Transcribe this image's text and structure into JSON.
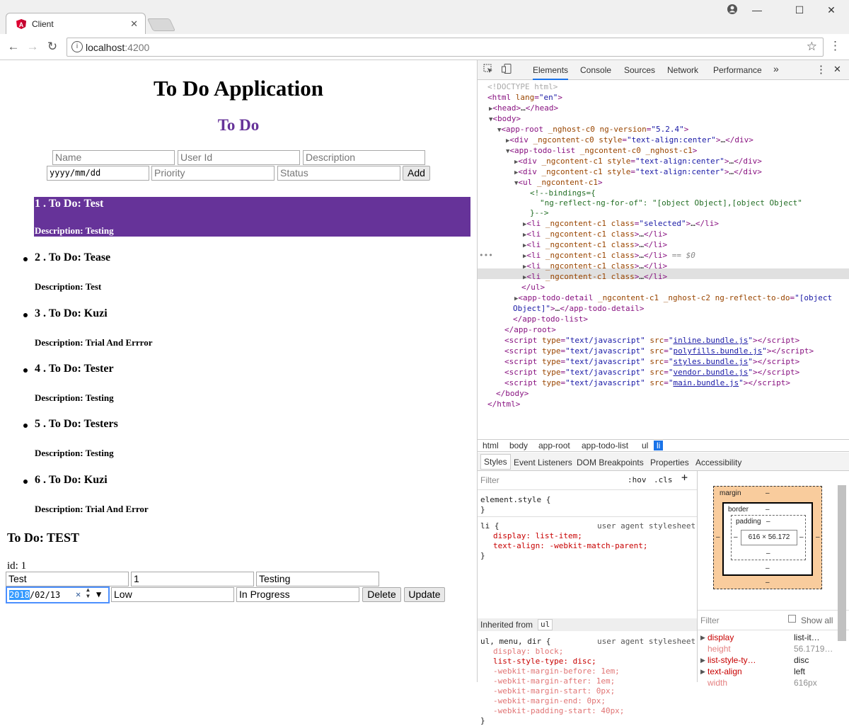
{
  "browser": {
    "tab_title": "Client",
    "url_host": "localhost",
    "url_port": ":4200"
  },
  "page": {
    "title": "To Do Application",
    "subtitle": "To Do",
    "form": {
      "name_placeholder": "Name",
      "userid_placeholder": "User Id",
      "description_placeholder": "Description",
      "date_placeholder": "yyyy/mm/dd",
      "priority_placeholder": "Priority",
      "status_placeholder": "Status",
      "add_label": "Add"
    },
    "items": [
      {
        "title": "1 . To Do: Test",
        "desc": "Description: Testing"
      },
      {
        "title": "2 . To Do: Tease",
        "desc": "Description: Test"
      },
      {
        "title": "3 . To Do: Kuzi",
        "desc": "Description: Trial And Errror"
      },
      {
        "title": "4 . To Do: Tester",
        "desc": "Description: Testing"
      },
      {
        "title": "5 . To Do: Testers",
        "desc": "Description: Testing"
      },
      {
        "title": "6 . To Do: Kuzi",
        "desc": "Description: Trial And Error"
      }
    ],
    "detail": {
      "title": "To Do: TEST",
      "id_label": "id: 1",
      "name_value": "Test",
      "userid_value": "1",
      "description_value": "Testing",
      "date_year": "2018",
      "date_rest": "/02/13",
      "priority_value": "Low",
      "status_value": "In Progress",
      "delete_label": "Delete",
      "update_label": "Update"
    }
  },
  "devtools": {
    "tabs": [
      "Elements",
      "Console",
      "Sources",
      "Network",
      "Performance"
    ],
    "breadcrumbs": [
      "html",
      "body",
      "app-root",
      "app-todo-list",
      "ul",
      "li"
    ],
    "style_tabs": [
      "Styles",
      "Event Listeners",
      "DOM Breakpoints",
      "Properties",
      "Accessibility"
    ],
    "filter_label": "Filter",
    "hov_label": ":hov",
    "cls_label": ".cls",
    "element_style": "element.style {",
    "li_selector": "li {",
    "user_agent": "user agent stylesheet",
    "li_display": "display: list-item;",
    "li_text_align": "text-align: -webkit-match-parent;",
    "inherited_from": "Inherited from",
    "inherited_tag": "ul",
    "ul_selector": "ul, menu, dir {",
    "ul_rules": [
      "display: block;",
      "list-style-type: disc;",
      "-webkit-margin-before: 1em;",
      "-webkit-margin-after: 1em;",
      "-webkit-margin-start: 0px;",
      "-webkit-margin-end: 0px;",
      "-webkit-padding-start: 40px;"
    ],
    "box_model": {
      "margin_label": "margin",
      "border_label": "border",
      "padding_label": "padding",
      "dash": "–",
      "content_size": "616 × 56.172"
    },
    "computed_filter": "Filter",
    "show_all": "Show all",
    "computed": [
      {
        "prop": "display",
        "value": "list-it…"
      },
      {
        "prop": "height",
        "value": "56.1719…"
      },
      {
        "prop": "list-style-ty…",
        "value": "disc"
      },
      {
        "prop": "text-align",
        "value": "left"
      },
      {
        "prop": "width",
        "value": "616px"
      }
    ]
  },
  "colors": {
    "accent": "#663399",
    "devtools_blue": "#1a73e8"
  }
}
